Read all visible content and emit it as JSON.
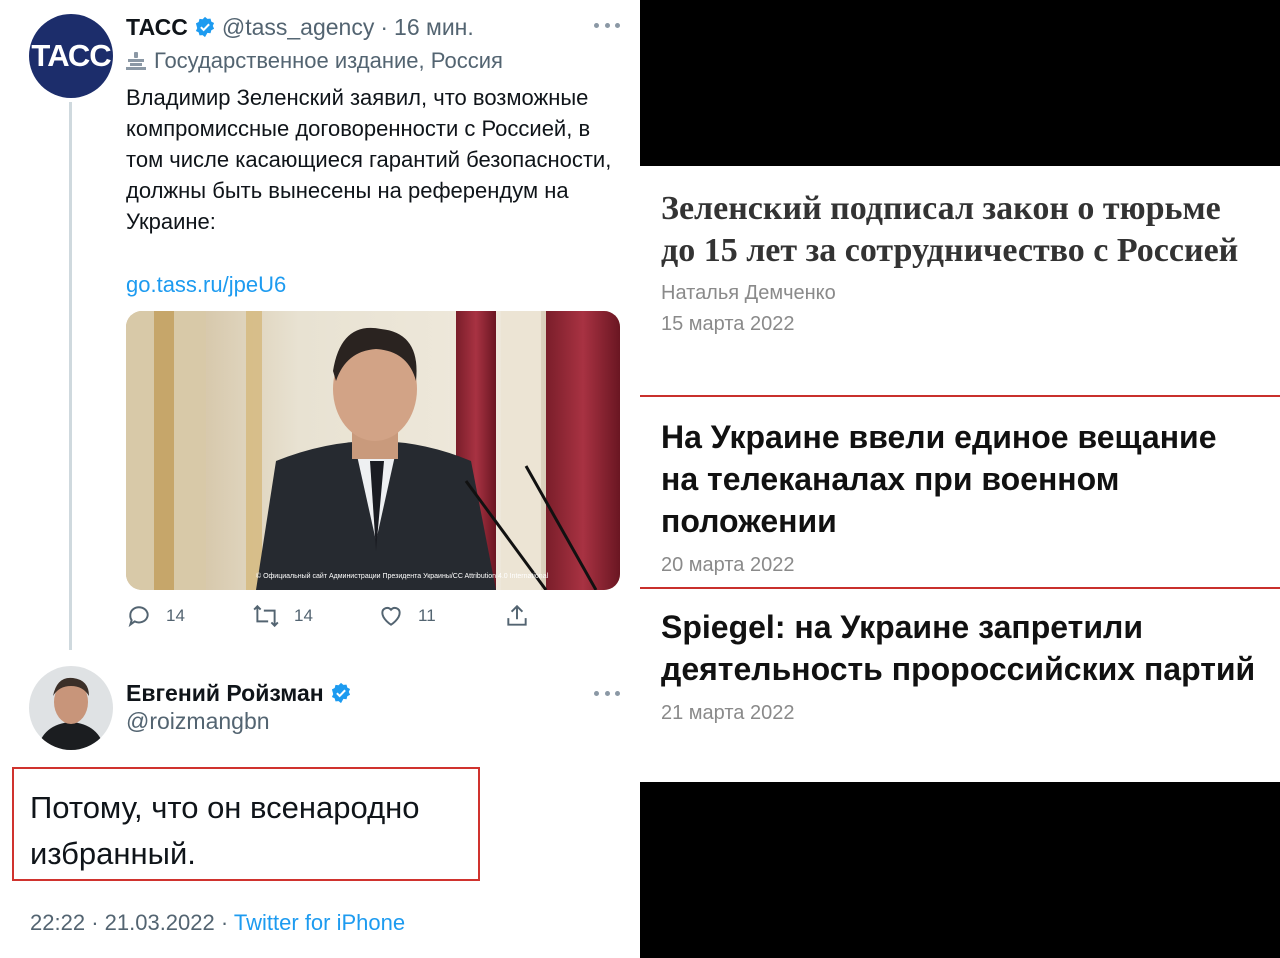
{
  "tweet1": {
    "avatar_text": "ТАСС",
    "name": "ТАСС",
    "handle": "@tass_agency",
    "separator": "·",
    "time": "16 мин.",
    "label": "Государственное издание, Россия",
    "text": "Владимир Зеленский заявил, что возможные компромиссные договоренности с Россией, в том числе касающиеся гарантий безопасности, должны быть вынесены на референдум на Украине:",
    "link": "go.tass.ru/jpeU6",
    "photo_credit": "© Официальный сайт Администрации Президента Украины/CC Attribution 4.0 International",
    "reply_count": "14",
    "retweet_count": "14",
    "like_count": "11"
  },
  "tweet2": {
    "name": "Евгений Ройзман",
    "handle": "@roizmangbn",
    "text": "Потому, что он всенародно избранный.",
    "time": "22:22",
    "separator": "·",
    "date": "21.03.2022",
    "source": "Twitter for iPhone"
  },
  "news": [
    {
      "headline": "Зеленский подписал закон о тюрьме до 15 лет за сотрудничество с Россией",
      "author": "Наталья Демченко",
      "date": "15 марта 2022"
    },
    {
      "headline": "На Украине ввели единое вещание на телеканалах при военном положении",
      "date": "20 марта 2022"
    },
    {
      "headline": "Spiegel: на Украине запретили деятельность пророссийских партий",
      "date": "21 марта 2022"
    }
  ],
  "colors": {
    "link": "#1d9bf0",
    "muted": "#536471",
    "highlight_border": "#d0332e",
    "news_divider": "#c9302c",
    "tass_blue": "#1c2d6b"
  }
}
